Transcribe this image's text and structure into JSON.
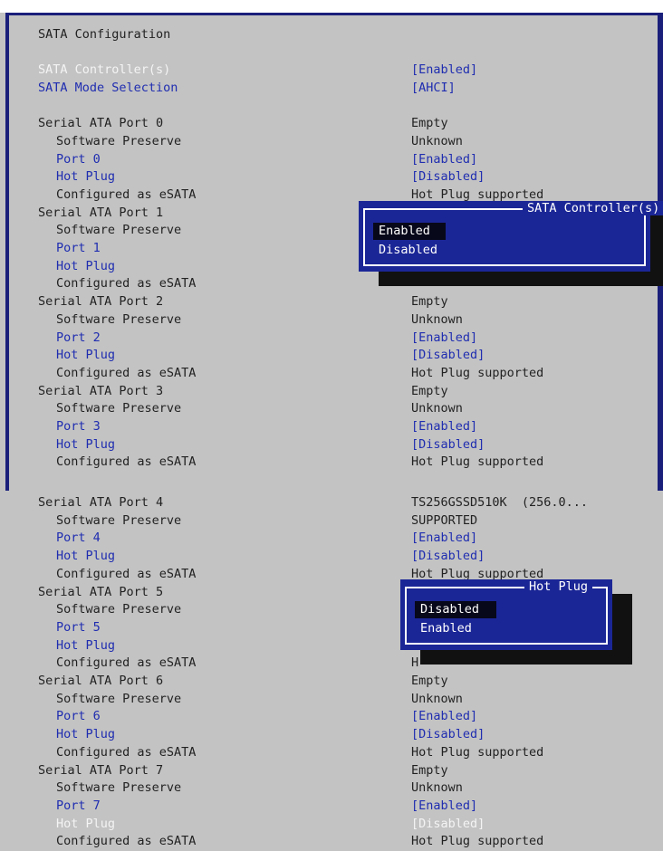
{
  "top": {
    "title": "SATA Configuration",
    "rows": [
      {
        "label": "SATA Controller(s)",
        "value": "[Enabled]",
        "label_color": "w",
        "value_color": "b",
        "indent": 0
      },
      {
        "label": "SATA Mode Selection",
        "value": "[AHCI]",
        "label_color": "b",
        "value_color": "b",
        "indent": 0
      },
      {
        "label": "",
        "value": "",
        "label_color": "k",
        "value_color": "k",
        "indent": 0
      },
      {
        "label": "Serial ATA Port 0",
        "value": "Empty",
        "label_color": "k",
        "value_color": "k",
        "indent": 0
      },
      {
        "label": "Software Preserve",
        "value": "Unknown",
        "label_color": "k",
        "value_color": "k",
        "indent": 1
      },
      {
        "label": "Port 0",
        "value": "[Enabled]",
        "label_color": "b",
        "value_color": "b",
        "indent": 1
      },
      {
        "label": "Hot Plug",
        "value": "[Disabled]",
        "label_color": "b",
        "value_color": "b",
        "indent": 1
      },
      {
        "label": "Configured as eSATA",
        "value": "Hot Plug supported",
        "label_color": "k",
        "value_color": "k",
        "indent": 1
      },
      {
        "label": "Serial ATA Port 1",
        "value": "",
        "label_color": "k",
        "value_color": "k",
        "indent": 0
      },
      {
        "label": "Software Preserve",
        "value": "",
        "label_color": "k",
        "value_color": "k",
        "indent": 1
      },
      {
        "label": "Port 1",
        "value": "",
        "label_color": "b",
        "value_color": "b",
        "indent": 1
      },
      {
        "label": "Hot Plug",
        "value": "",
        "label_color": "b",
        "value_color": "b",
        "indent": 1
      },
      {
        "label": "Configured as eSATA",
        "value": "",
        "label_color": "k",
        "value_color": "k",
        "indent": 1
      },
      {
        "label": "Serial ATA Port 2",
        "value": "Empty",
        "label_color": "k",
        "value_color": "k",
        "indent": 0
      },
      {
        "label": "Software Preserve",
        "value": "Unknown",
        "label_color": "k",
        "value_color": "k",
        "indent": 1
      },
      {
        "label": "Port 2",
        "value": "[Enabled]",
        "label_color": "b",
        "value_color": "b",
        "indent": 1
      },
      {
        "label": "Hot Plug",
        "value": "[Disabled]",
        "label_color": "b",
        "value_color": "b",
        "indent": 1
      },
      {
        "label": "Configured as eSATA",
        "value": "Hot Plug supported",
        "label_color": "k",
        "value_color": "k",
        "indent": 1
      },
      {
        "label": "Serial ATA Port 3",
        "value": "Empty",
        "label_color": "k",
        "value_color": "k",
        "indent": 0
      },
      {
        "label": "Software Preserve",
        "value": "Unknown",
        "label_color": "k",
        "value_color": "k",
        "indent": 1
      },
      {
        "label": "Port 3",
        "value": "[Enabled]",
        "label_color": "b",
        "value_color": "b",
        "indent": 1
      },
      {
        "label": "Hot Plug",
        "value": "[Disabled]",
        "label_color": "b",
        "value_color": "b",
        "indent": 1
      },
      {
        "label": "Configured as eSATA",
        "value": "Hot Plug supported",
        "label_color": "k",
        "value_color": "k",
        "indent": 1
      }
    ],
    "popup": {
      "title": "SATA Controller(s)",
      "options": [
        "Enabled",
        "Disabled"
      ],
      "selected": 0
    }
  },
  "bottom": {
    "rows": [
      {
        "label": "Serial ATA Port 4",
        "value": "TS256GSSD510K  (256.0...",
        "label_color": "k",
        "value_color": "k",
        "indent": 0
      },
      {
        "label": "Software Preserve",
        "value": "SUPPORTED",
        "label_color": "k",
        "value_color": "k",
        "indent": 1
      },
      {
        "label": "Port 4",
        "value": "[Enabled]",
        "label_color": "b",
        "value_color": "b",
        "indent": 1
      },
      {
        "label": "Hot Plug",
        "value": "[Disabled]",
        "label_color": "b",
        "value_color": "b",
        "indent": 1
      },
      {
        "label": "Configured as eSATA",
        "value": "Hot Plug supported",
        "label_color": "k",
        "value_color": "k",
        "indent": 1
      },
      {
        "label": "Serial ATA Port 5",
        "value": "",
        "label_color": "k",
        "value_color": "k",
        "indent": 0
      },
      {
        "label": "Software Preserve",
        "value": "",
        "label_color": "k",
        "value_color": "k",
        "indent": 1
      },
      {
        "label": "Port 5",
        "value": "",
        "label_color": "b",
        "value_color": "b",
        "indent": 1
      },
      {
        "label": "Hot Plug",
        "value": "",
        "label_color": "b",
        "value_color": "b",
        "indent": 1
      },
      {
        "label": "Configured as eSATA",
        "value": "H",
        "label_color": "k",
        "value_color": "k",
        "indent": 1
      },
      {
        "label": "Serial ATA Port 6",
        "value": "Empty",
        "label_color": "k",
        "value_color": "k",
        "indent": 0
      },
      {
        "label": "Software Preserve",
        "value": "Unknown",
        "label_color": "k",
        "value_color": "k",
        "indent": 1
      },
      {
        "label": "Port 6",
        "value": "[Enabled]",
        "label_color": "b",
        "value_color": "b",
        "indent": 1
      },
      {
        "label": "Hot Plug",
        "value": "[Disabled]",
        "label_color": "b",
        "value_color": "b",
        "indent": 1
      },
      {
        "label": "Configured as eSATA",
        "value": "Hot Plug supported",
        "label_color": "k",
        "value_color": "k",
        "indent": 1
      },
      {
        "label": "Serial ATA Port 7",
        "value": "Empty",
        "label_color": "k",
        "value_color": "k",
        "indent": 0
      },
      {
        "label": "Software Preserve",
        "value": "Unknown",
        "label_color": "k",
        "value_color": "k",
        "indent": 1
      },
      {
        "label": "Port 7",
        "value": "[Enabled]",
        "label_color": "b",
        "value_color": "b",
        "indent": 1
      },
      {
        "label": "Hot Plug",
        "value": "[Disabled]",
        "label_color": "w",
        "value_color": "w",
        "indent": 1
      },
      {
        "label": "Configured as eSATA",
        "value": "Hot Plug supported",
        "label_color": "k",
        "value_color": "k",
        "indent": 1
      }
    ],
    "popup": {
      "title": "Hot Plug",
      "options": [
        "Disabled",
        "Enabled"
      ],
      "selected": 0
    }
  },
  "colors": {
    "background": "#c3c3c3",
    "frame": "#1a1f7a",
    "popup": "#1b2696",
    "link_text": "#1f2db0",
    "highlight_text": "#f4f4f4",
    "plain_text": "#222222"
  }
}
